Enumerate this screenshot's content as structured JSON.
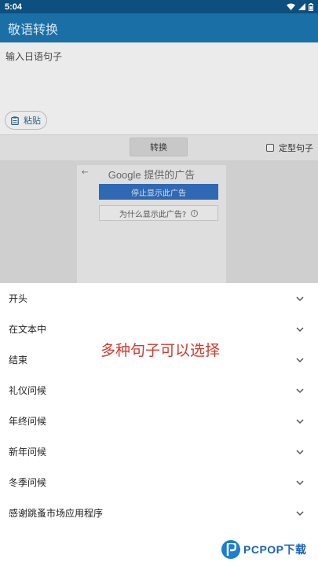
{
  "status_bar": {
    "time": "5:04"
  },
  "app_bar": {
    "title": "敬语转换"
  },
  "input": {
    "placeholder": "输入日语句子",
    "paste_label": "粘贴"
  },
  "convert": {
    "button_label": "转换",
    "fixed_sentence_label": "定型句子"
  },
  "ad": {
    "header": "Google 提供的广告",
    "stop_label": "停止显示此广告",
    "why_label": "为什么显示此广告?"
  },
  "sheet": {
    "items": [
      {
        "label": "开头"
      },
      {
        "label": "在文本中"
      },
      {
        "label": "结束"
      },
      {
        "label": "礼仪问候"
      },
      {
        "label": "年终问候"
      },
      {
        "label": "新年问候"
      },
      {
        "label": "冬季问候"
      },
      {
        "label": "感谢跳蚤市场应用程序"
      }
    ]
  },
  "overlay_caption": "多种句子可以选择",
  "watermark": {
    "brand": "PCPOP下载"
  },
  "colors": {
    "status_bar": "#0d4f7f",
    "app_bar": "#1b6fa7",
    "caption_red": "#d23a2e",
    "ad_button_blue": "#2f68b3"
  }
}
